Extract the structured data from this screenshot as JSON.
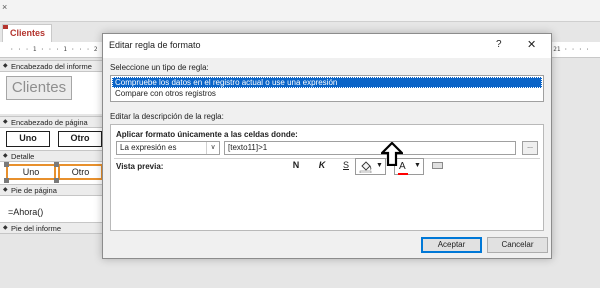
{
  "background": {
    "close_glyph": "×",
    "tab_label": "Clientes",
    "ruler_left": "· · · 1 · · · 1 · · · 2 · · · 1 · · · 3",
    "ruler_right": "· 21 · · · ·",
    "sections": {
      "report_header": "Encabezado del informe",
      "page_header": "Encabezado de página",
      "detail": "Detalle",
      "page_footer": "Pie de página",
      "report_footer": "Pie del informe"
    },
    "controls": {
      "title": "Clientes",
      "header_uno": "Uno",
      "header_otro": "Otro",
      "detail_uno": "Uno",
      "detail_otro": "Otro",
      "footer_expr": "=Ahora()"
    }
  },
  "dialog": {
    "title": "Editar regla de formato",
    "help_glyph": "?",
    "close_glyph": "✕",
    "select_type_label": "Seleccione un tipo de regla:",
    "rule_types": [
      "Compruebe los datos en el registro actual o use una expresión",
      "Compare con otros registros"
    ],
    "selected_rule_index": 0,
    "edit_description_label": "Editar la descripción de la regla:",
    "apply_label": "Aplicar formato únicamente a las celdas donde:",
    "condition": {
      "value": "La expresión es",
      "dropdown_glyph": "∨"
    },
    "expression_value": "[texto11]>1",
    "expression_builder_glyph": "...",
    "preview_label": "Vista previa:",
    "format_buttons": {
      "bold": "N",
      "italic": "K",
      "underline": "S",
      "font_color_letter": "A",
      "dropdown_glyph": "▼"
    },
    "accept_label": "Aceptar",
    "cancel_label": "Cancelar"
  },
  "colors": {
    "tab_accent": "#b4342e",
    "selection": "#0a64c8",
    "control_selection": "#e8902c",
    "font_color": "#ff0000",
    "fill_color": "#ffffff"
  }
}
